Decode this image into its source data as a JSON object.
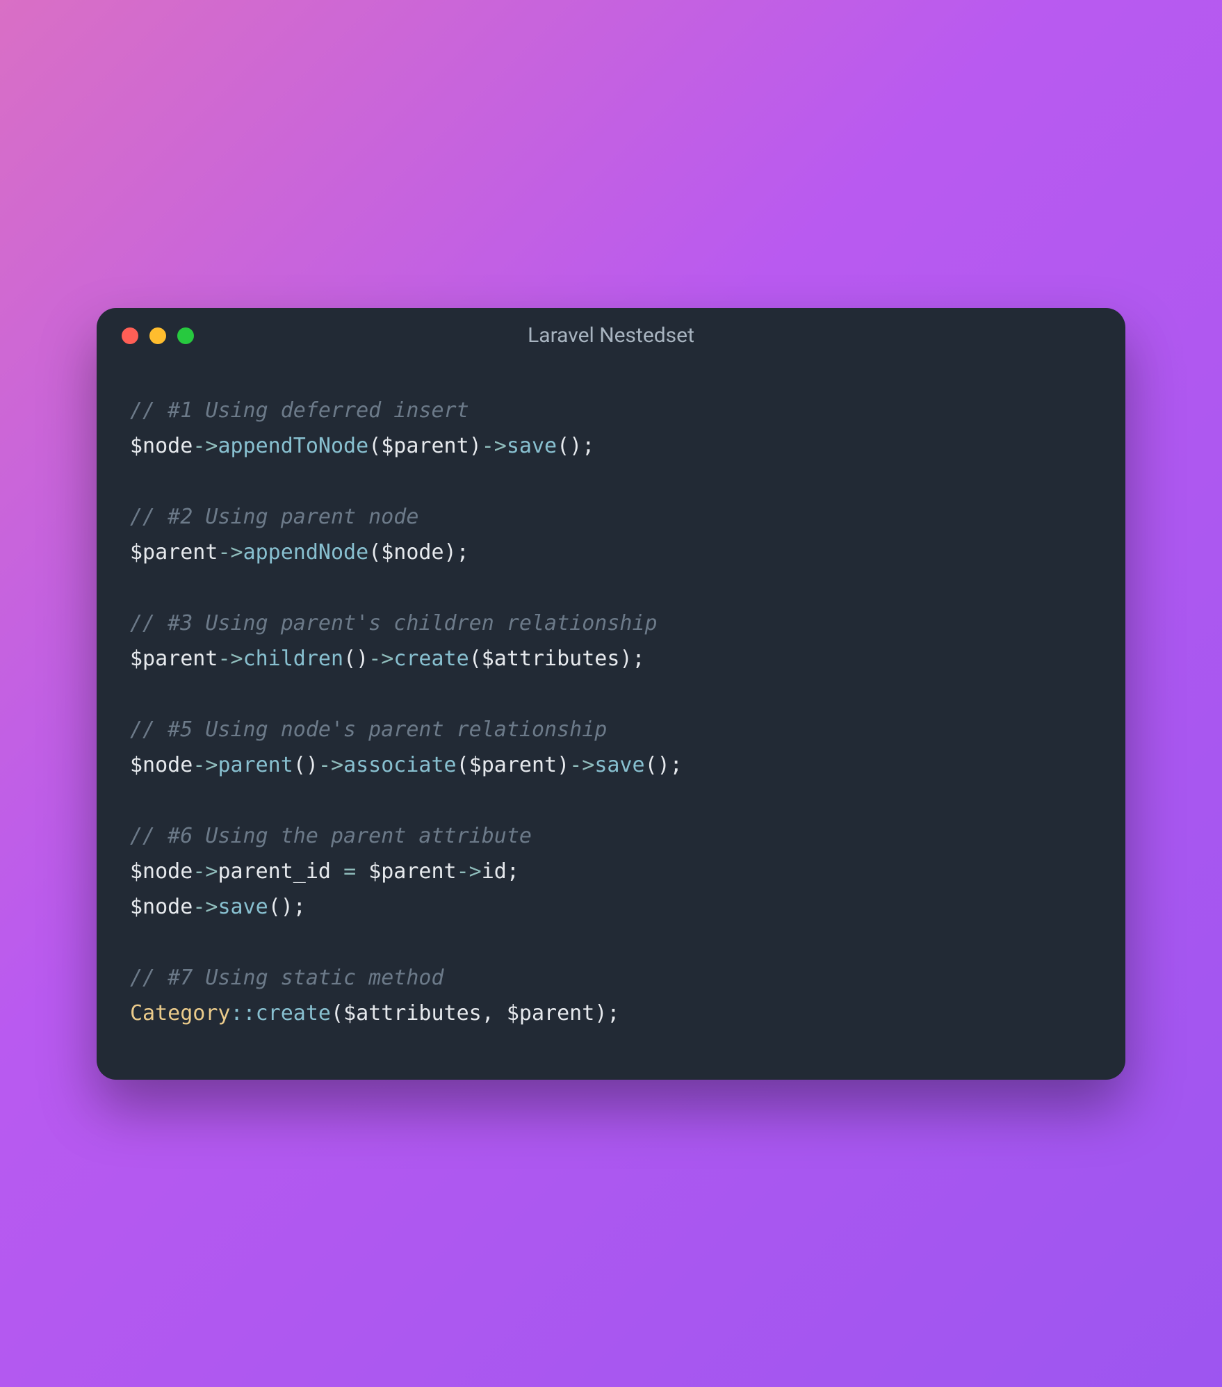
{
  "window": {
    "title": "Laravel Nestedset"
  },
  "code": {
    "lines": [
      {
        "type": "comment",
        "text": "// #1 Using deferred insert"
      },
      {
        "type": "code",
        "tokens": [
          {
            "c": "var",
            "t": "$node"
          },
          {
            "c": "op",
            "t": "->"
          },
          {
            "c": "method",
            "t": "appendToNode"
          },
          {
            "c": "paren",
            "t": "("
          },
          {
            "c": "var",
            "t": "$parent"
          },
          {
            "c": "paren",
            "t": ")"
          },
          {
            "c": "op",
            "t": "->"
          },
          {
            "c": "method",
            "t": "save"
          },
          {
            "c": "paren",
            "t": "();"
          }
        ]
      },
      {
        "type": "blank"
      },
      {
        "type": "comment",
        "text": "// #2 Using parent node"
      },
      {
        "type": "code",
        "tokens": [
          {
            "c": "var",
            "t": "$parent"
          },
          {
            "c": "op",
            "t": "->"
          },
          {
            "c": "method",
            "t": "appendNode"
          },
          {
            "c": "paren",
            "t": "("
          },
          {
            "c": "var",
            "t": "$node"
          },
          {
            "c": "paren",
            "t": ");"
          }
        ]
      },
      {
        "type": "blank"
      },
      {
        "type": "comment",
        "text": "// #3 Using parent's children relationship"
      },
      {
        "type": "code",
        "tokens": [
          {
            "c": "var",
            "t": "$parent"
          },
          {
            "c": "op",
            "t": "->"
          },
          {
            "c": "method",
            "t": "children"
          },
          {
            "c": "paren",
            "t": "()"
          },
          {
            "c": "op",
            "t": "->"
          },
          {
            "c": "method",
            "t": "create"
          },
          {
            "c": "paren",
            "t": "("
          },
          {
            "c": "var",
            "t": "$attributes"
          },
          {
            "c": "paren",
            "t": ");"
          }
        ]
      },
      {
        "type": "blank"
      },
      {
        "type": "comment",
        "text": "// #5 Using node's parent relationship"
      },
      {
        "type": "code",
        "tokens": [
          {
            "c": "var",
            "t": "$node"
          },
          {
            "c": "op",
            "t": "->"
          },
          {
            "c": "method",
            "t": "parent"
          },
          {
            "c": "paren",
            "t": "()"
          },
          {
            "c": "op",
            "t": "->"
          },
          {
            "c": "method",
            "t": "associate"
          },
          {
            "c": "paren",
            "t": "("
          },
          {
            "c": "var",
            "t": "$parent"
          },
          {
            "c": "paren",
            "t": ")"
          },
          {
            "c": "op",
            "t": "->"
          },
          {
            "c": "method",
            "t": "save"
          },
          {
            "c": "paren",
            "t": "();"
          }
        ]
      },
      {
        "type": "blank"
      },
      {
        "type": "comment",
        "text": "// #6 Using the parent attribute"
      },
      {
        "type": "code",
        "tokens": [
          {
            "c": "var",
            "t": "$node"
          },
          {
            "c": "op",
            "t": "->"
          },
          {
            "c": "var",
            "t": "parent_id "
          },
          {
            "c": "op",
            "t": "= "
          },
          {
            "c": "var",
            "t": "$parent"
          },
          {
            "c": "op",
            "t": "->"
          },
          {
            "c": "var",
            "t": "id"
          },
          {
            "c": "paren",
            "t": ";"
          }
        ]
      },
      {
        "type": "code",
        "tokens": [
          {
            "c": "var",
            "t": "$node"
          },
          {
            "c": "op",
            "t": "->"
          },
          {
            "c": "method",
            "t": "save"
          },
          {
            "c": "paren",
            "t": "();"
          }
        ]
      },
      {
        "type": "blank"
      },
      {
        "type": "comment",
        "text": "// #7 Using static method"
      },
      {
        "type": "code",
        "tokens": [
          {
            "c": "class",
            "t": "Category"
          },
          {
            "c": "dbl",
            "t": "::"
          },
          {
            "c": "method",
            "t": "create"
          },
          {
            "c": "paren",
            "t": "("
          },
          {
            "c": "var",
            "t": "$attributes"
          },
          {
            "c": "paren",
            "t": ", "
          },
          {
            "c": "var",
            "t": "$parent"
          },
          {
            "c": "paren",
            "t": ");"
          }
        ]
      }
    ]
  }
}
